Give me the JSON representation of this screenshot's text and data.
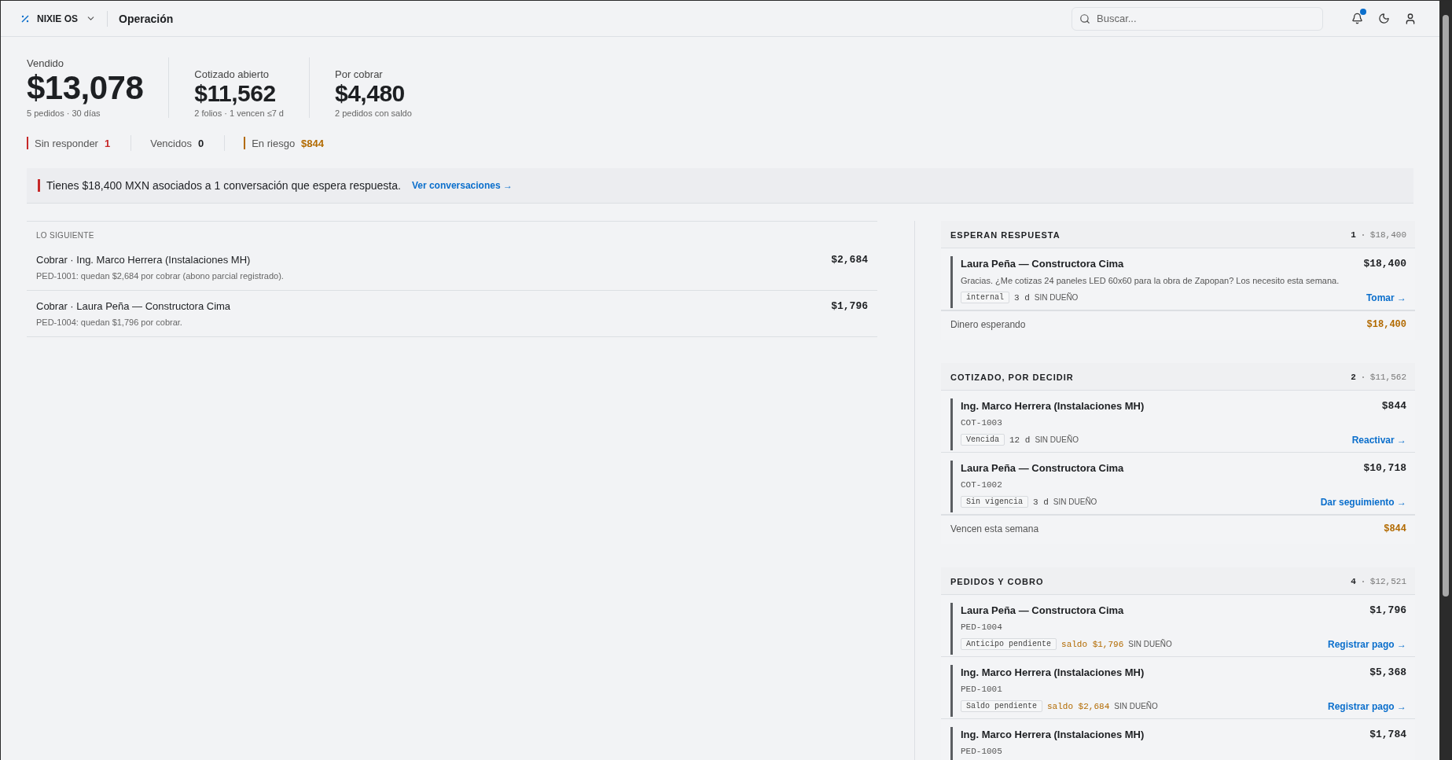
{
  "header": {
    "brand": "NIXIE OS",
    "page_title": "Operación",
    "search": {
      "placeholder": "Buscar..."
    },
    "notifications_unread": true
  },
  "kpis": [
    {
      "kind": "primary",
      "label": "Vendido",
      "value": "$13,078",
      "note": "5 pedidos · 30 días"
    },
    {
      "kind": "secondary",
      "label": "Cotizado abierto",
      "value": "$11,562",
      "note": "2 folios · 1 vencen ≤7 d"
    },
    {
      "kind": "secondary",
      "label": "Por cobrar",
      "value": "$4,480",
      "note": "2 pedidos con saldo"
    }
  ],
  "indicators": [
    {
      "label": "Sin responder",
      "value": "1",
      "color": "#c62828"
    },
    {
      "label": "Vencidos",
      "value": "0"
    },
    {
      "label": "En riesgo",
      "value": "$844",
      "color": "#b26a00"
    }
  ],
  "alert": {
    "text": "Tienes $18,400 MXN asociados a 1 conversación que espera respuesta.",
    "link": "Ver conversaciones →"
  },
  "next": {
    "title": "LO SIGUIENTE",
    "items": [
      {
        "title": "Cobrar · Ing. Marco Herrera (Instalaciones MH)",
        "detail": "PED-1001: quedan $2,684 por cobrar (abono parcial registrado).",
        "amount": "$2,684"
      },
      {
        "title": "Cobrar · Laura Peña — Constructora Cima",
        "detail": "PED-1004: quedan $1,796 por cobrar.",
        "amount": "$1,796"
      }
    ]
  },
  "sections": [
    {
      "title": "ESPERAN RESPUESTA",
      "count": "1",
      "total": "$18,400",
      "items": [
        {
          "name": "Laura Peña — Constructora Cima",
          "amount": "$18,400",
          "message": "Gracias. ¿Me cotizas 24 paneles LED 60x60 para la obra de Zapopan? Los necesito esta semana.",
          "tag": "internal",
          "age": "3 d",
          "owner": "SIN DUEÑO",
          "action": "Tomar →"
        }
      ],
      "footer": {
        "label": "Dinero esperando",
        "value": "$18,400"
      }
    },
    {
      "title": "COTIZADO, POR DECIDIR",
      "count": "2",
      "total": "$11,562",
      "items": [
        {
          "name": "Ing. Marco Herrera (Instalaciones MH)",
          "amount": "$844",
          "ref": "COT-1003",
          "tag": "Vencida",
          "age": "12 d",
          "owner": "SIN DUEÑO",
          "action": "Reactivar →"
        },
        {
          "name": "Laura Peña — Constructora Cima",
          "amount": "$10,718",
          "ref": "COT-1002",
          "tag": "Sin vigencia",
          "age": "3 d",
          "owner": "SIN DUEÑO",
          "action": "Dar seguimiento →"
        }
      ],
      "footer": {
        "label": "Vencen esta semana",
        "value": "$844"
      }
    },
    {
      "title": "PEDIDOS Y COBRO",
      "count": "4",
      "total": "$12,521",
      "items": [
        {
          "name": "Laura Peña — Constructora Cima",
          "amount": "$1,796",
          "ref": "PED-1004",
          "tag": "Anticipo pendiente",
          "balance": "saldo $1,796",
          "owner": "SIN DUEÑO",
          "action": "Registrar pago →"
        },
        {
          "name": "Ing. Marco Herrera (Instalaciones MH)",
          "amount": "$5,368",
          "ref": "PED-1001",
          "tag": "Saldo pendiente",
          "balance": "saldo $2,684",
          "owner": "SIN DUEÑO",
          "action": "Registrar pago →"
        },
        {
          "name": "Ing. Marco Herrera (Instalaciones MH)",
          "amount": "$1,784",
          "ref": "PED-1005"
        }
      ]
    }
  ]
}
